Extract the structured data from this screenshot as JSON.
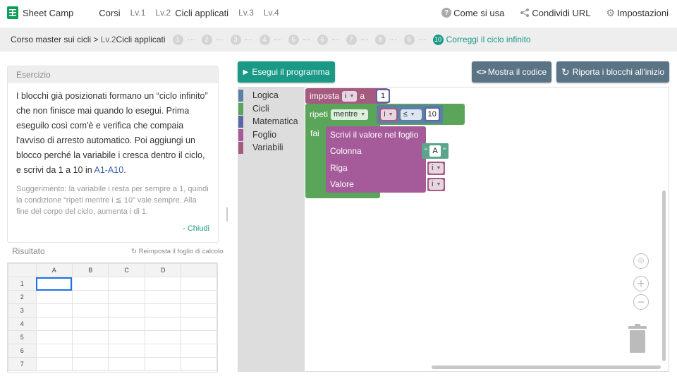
{
  "header": {
    "app_name": "Sheet Camp",
    "nav_courses": "Corsi",
    "levels": [
      "Lv.1",
      "Lv.2",
      "Lv.3",
      "Lv.4"
    ],
    "current_level_title": "Cicli applicati",
    "how_to": "Come si usa",
    "share": "Condividi URL",
    "settings": "Impostazioni"
  },
  "breadcrumb": {
    "course": "Corso master sui cicli",
    "separator": ">",
    "level": "Lv.2",
    "level_title": "Cicli applicati",
    "steps": [
      "1",
      "2",
      "3",
      "4",
      "5",
      "6",
      "7",
      "8",
      "9"
    ],
    "active_step": "10",
    "active_step_label": "Correggi il ciclo infinito"
  },
  "exercise": {
    "header": "Esercizio",
    "text_main": "I blocchi già posizionati formano un “ciclo infinito” che non finisce mai quando lo esegui. Prima eseguilo così com'è e verifica che compaia l'avviso di arresto automatico. Poi aggiungi un blocco perché la variabile i cresca dentro il ciclo, e scrivi da 1 a 10 in ",
    "text_ref": "A1-A10",
    "text_end": ".",
    "hint": "Suggerimento: la variabile i resta per sempre a 1, quindi la condizione “ripeti mentre i ≦ 10” vale sempre. Alla fine del corpo del ciclo, aumenta i di 1.",
    "close": "- Chiudi"
  },
  "result": {
    "header": "Risultato",
    "reset_sheet": "Reimposta il foglio di calcolo",
    "columns": [
      "A",
      "B",
      "C",
      "D"
    ],
    "rows": [
      "1",
      "2",
      "3",
      "4",
      "5",
      "6",
      "7"
    ]
  },
  "buttons": {
    "run": "Esegui il programma",
    "show_code": "Mostra il codice",
    "reset_blocks": "Riporta i blocchi all'inizio"
  },
  "toolbox": [
    {
      "label": "Logica",
      "color": "#5b80a5"
    },
    {
      "label": "Cicli",
      "color": "#5ba55b"
    },
    {
      "label": "Matematica",
      "color": "#5b67a5"
    },
    {
      "label": "Foglio",
      "color": "#a55b99"
    },
    {
      "label": "Variabili",
      "color": "#a55b80"
    }
  ],
  "blocks": {
    "set_label": "imposta",
    "set_var": "i",
    "set_to": "a",
    "set_value": "1",
    "repeat_label": "ripeti",
    "repeat_mode": "mentre",
    "cond_var": "i",
    "cond_op": "≤",
    "cond_value": "10",
    "do_label": "fai",
    "write_label": "Scrivi il valore nel foglio",
    "col_label": "Colonna",
    "col_value": "A",
    "row_label": "Riga",
    "row_var": "i",
    "value_label": "Valore",
    "value_var": "i"
  },
  "colors": {
    "accent": "#1a9a86",
    "button_secondary": "#5a7485",
    "variables": "#a55b80",
    "loops": "#5ba55b",
    "logic": "#5b80a5",
    "math": "#5b67a5",
    "sheet": "#a55b99",
    "text_block": "#5ba58c"
  }
}
